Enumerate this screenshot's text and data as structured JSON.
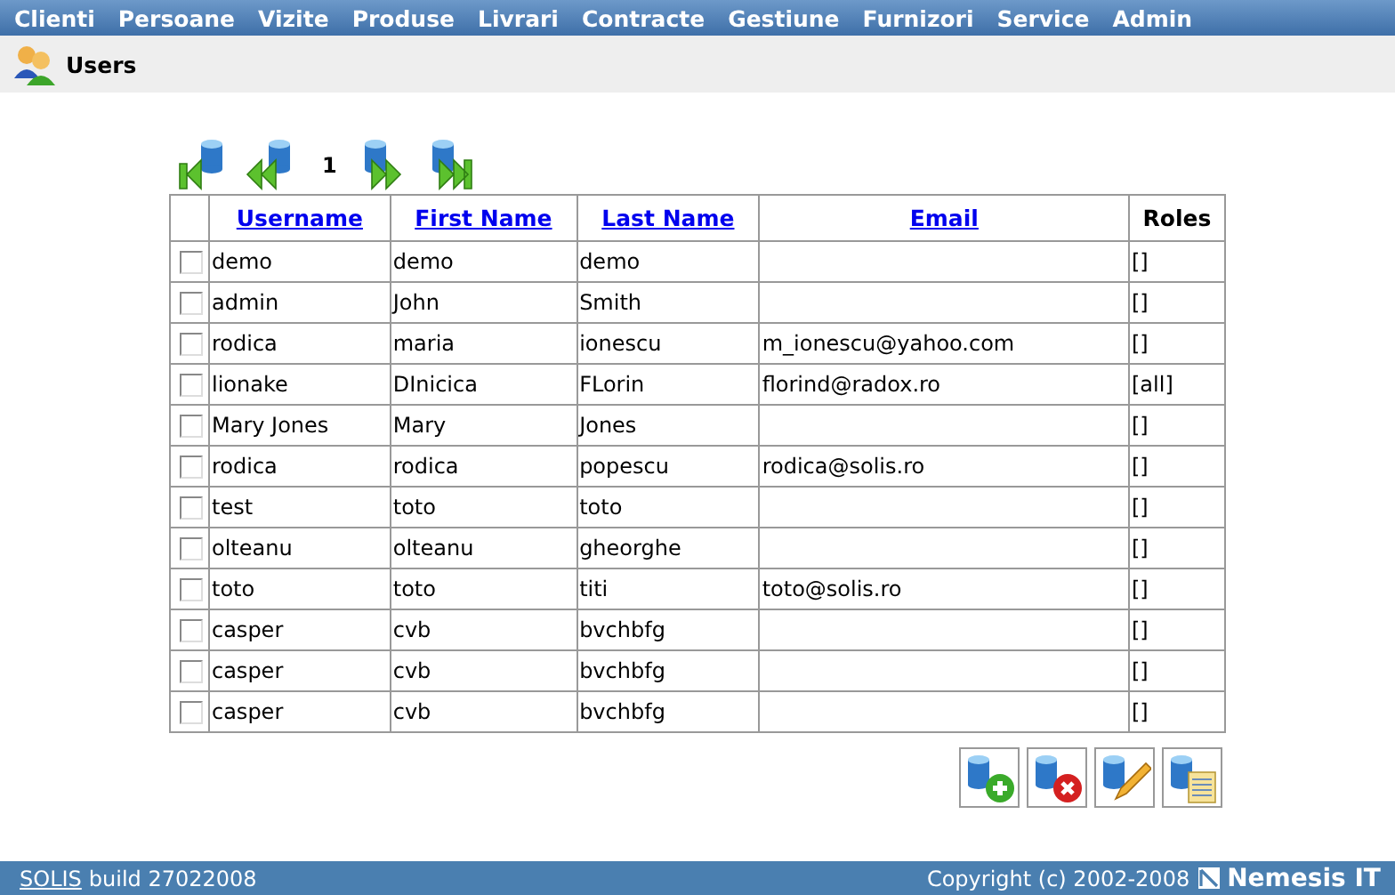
{
  "menu": [
    "Clienti",
    "Persoane",
    "Vizite",
    "Produse",
    "Livrari",
    "Contracte",
    "Gestiune",
    "Furnizori",
    "Service",
    "Admin"
  ],
  "page_title": "Users",
  "pager": {
    "page": "1"
  },
  "table": {
    "columns": [
      {
        "label": "Username",
        "kind": "link"
      },
      {
        "label": "First Name",
        "kind": "link"
      },
      {
        "label": "Last Name",
        "kind": "link"
      },
      {
        "label": "Email",
        "kind": "link"
      },
      {
        "label": "Roles",
        "kind": "plain"
      }
    ],
    "rows": [
      {
        "checked": false,
        "cells": [
          "demo",
          "demo",
          "demo",
          "",
          "[]"
        ]
      },
      {
        "checked": false,
        "cells": [
          "admin",
          "John",
          "Smith",
          "",
          "[]"
        ]
      },
      {
        "checked": false,
        "cells": [
          "rodica",
          "maria",
          "ionescu",
          "m_ionescu@yahoo.com",
          "[]"
        ]
      },
      {
        "checked": false,
        "cells": [
          "lionake",
          "DInicica",
          "FLorin",
          "florind@radox.ro",
          "[all]"
        ]
      },
      {
        "checked": false,
        "cells": [
          "Mary Jones",
          "Mary",
          "Jones",
          "",
          "[]"
        ]
      },
      {
        "checked": false,
        "cells": [
          "rodica",
          "rodica",
          "popescu",
          "rodica@solis.ro",
          "[]"
        ]
      },
      {
        "checked": false,
        "cells": [
          "test",
          "toto",
          "toto",
          "",
          "[]"
        ]
      },
      {
        "checked": false,
        "cells": [
          "olteanu",
          "olteanu",
          "gheorghe",
          "",
          "[]"
        ]
      },
      {
        "checked": false,
        "cells": [
          "toto",
          "toto",
          "titi",
          "toto@solis.ro",
          "[]"
        ]
      },
      {
        "checked": false,
        "cells": [
          "casper",
          "cvb",
          "bvchbfg",
          "",
          "[]"
        ]
      },
      {
        "checked": false,
        "cells": [
          "casper",
          "cvb",
          "bvchbfg",
          "",
          "[]"
        ]
      },
      {
        "checked": false,
        "cells": [
          "casper",
          "cvb",
          "bvchbfg",
          "",
          "[]"
        ]
      }
    ]
  },
  "actions": [
    {
      "kind": "add"
    },
    {
      "kind": "delete"
    },
    {
      "kind": "edit"
    },
    {
      "kind": "details"
    }
  ],
  "footer": {
    "app_link": "SOLIS",
    "build": "build 27022008",
    "copyright": "Copyright (c) 2002-2008",
    "brand": "Nemesis IT"
  }
}
